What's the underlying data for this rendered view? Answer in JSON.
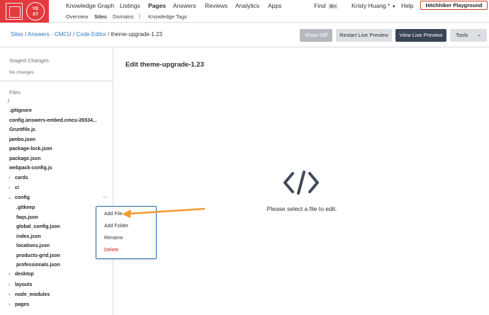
{
  "logo": {
    "text": "YE\nXT"
  },
  "topnav": {
    "items": [
      {
        "label": "Knowledge Graph"
      },
      {
        "label": "Listings"
      },
      {
        "label": "Pages"
      },
      {
        "label": "Answers"
      },
      {
        "label": "Reviews"
      },
      {
        "label": "Analytics"
      },
      {
        "label": "Apps"
      }
    ],
    "find_label": "Find",
    "find_shortcut": "⌘K",
    "user_name": "Kristy Huang",
    "user_suffix": "*",
    "help_label": "Help",
    "environment_label": "Hitchhiker Playground",
    "accent_color": "#e4393d"
  },
  "subnav": {
    "items": [
      {
        "label": "Overview"
      },
      {
        "label": "Sites"
      },
      {
        "label": "Domains"
      },
      {
        "label": "Knowledge Tags"
      }
    ],
    "separator": "|"
  },
  "breadcrumb": {
    "parts": [
      "Sites",
      "Answers - CMCU",
      "Code Editor"
    ],
    "separator": "/",
    "current": "theme-upgrade-1.23"
  },
  "toolbar": {
    "show_diff": "Show Diff",
    "restart_preview": "Restart Live Preview",
    "view_preview": "View Live Preview",
    "tools": "Tools"
  },
  "sidebar": {
    "staged_title": "Staged Changes",
    "staged_empty": "No changes",
    "files_title": "Files",
    "root": "/",
    "files": [
      {
        "name": ".gitignore"
      },
      {
        "name": "config.answers-embed.cmcu-26534..."
      },
      {
        "name": "Gruntfile.js"
      },
      {
        "name": "jambo.json"
      },
      {
        "name": "package-lock.json"
      },
      {
        "name": "package.json"
      },
      {
        "name": "webpack-config.js"
      }
    ],
    "folders_top": [
      {
        "name": "cards"
      },
      {
        "name": "ci"
      }
    ],
    "open_folder": "config",
    "more_glyph": "···",
    "config_children": [
      {
        "name": ".gitkeep"
      },
      {
        "name": "faqs.json"
      },
      {
        "name": "global_config.json"
      },
      {
        "name": "index.json"
      },
      {
        "name": "locations.json"
      },
      {
        "name": "products-grid.json"
      },
      {
        "name": "professionals.json"
      }
    ],
    "folders_bottom": [
      {
        "name": "desktop"
      },
      {
        "name": "layouts"
      },
      {
        "name": "node_modules"
      },
      {
        "name": "pages"
      }
    ]
  },
  "context_menu": {
    "items": [
      {
        "label": "Add File"
      },
      {
        "label": "Add Folder"
      },
      {
        "label": "Rename"
      },
      {
        "label": "Delete"
      }
    ],
    "danger_color": "#c8202b"
  },
  "main": {
    "title": "Edit theme-upgrade-1.23",
    "empty_message": "Please select a file to edit.",
    "icon": "code-brackets-icon",
    "annotation_arrow_color": "#f29a2e"
  }
}
